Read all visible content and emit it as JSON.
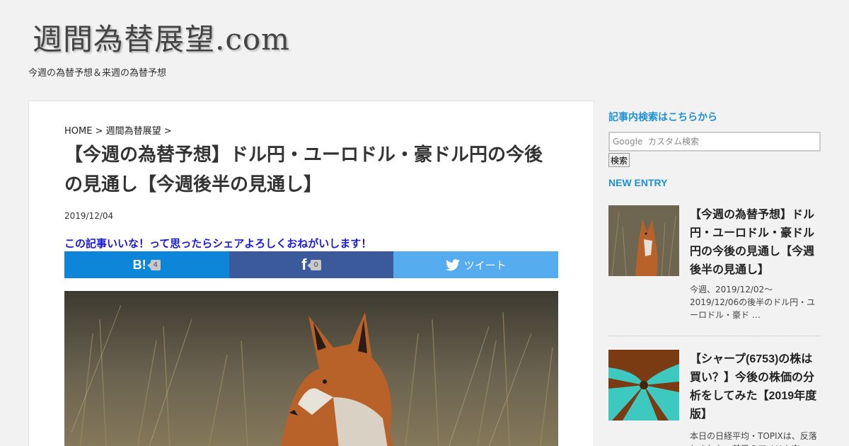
{
  "site": {
    "title": "週間為替展望.com",
    "description": "今週の為替予想＆来週の為替予想"
  },
  "breadcrumb": {
    "home": "HOME",
    "separator": ">",
    "category": "週間為替展望"
  },
  "post": {
    "title": "【今週の為替予想】ドル円・ユーロドル・豪ドル円の今後の見通し【今週後半の見通し】",
    "date": "2019/12/04",
    "share_message": "この記事いいな！って思ったらシェアよろしくおねがいします！"
  },
  "share": {
    "hatena_label": "B!",
    "hatena_count": "4",
    "facebook_label": "f",
    "facebook_count": "0",
    "twitter_label": "ツイート",
    "colors": {
      "hatena": "#0d86d9",
      "facebook": "#3b5a9c",
      "twitter": "#55acee"
    }
  },
  "sidebar": {
    "search_heading": "記事内検索はこちらから",
    "search_placeholder": "Google  カスタム検索",
    "search_button": "検索",
    "new_entry_heading": "NEW ENTRY",
    "entries": [
      {
        "title": "【今週の為替予想】ドル円・ユーロドル・豪ドル円の今後の見通し【今週後半の見通し】",
        "excerpt": "今週、2019/12/02～2019/12/06の後半のドル円・ユーロドル・豪ド …"
      },
      {
        "title": "【シャープ(6753)の株は買い？】今後の株価の分析をしてみた【2019年度版】",
        "excerpt": "本日の日経平均・TOPIXは、反落しました。前日のアメリカ市"
      }
    ]
  },
  "accent_color": "#1e90d6"
}
